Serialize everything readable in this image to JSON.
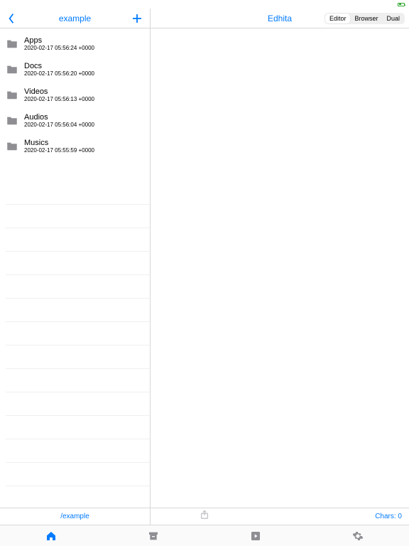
{
  "statusbar": {
    "indicator": ""
  },
  "nav": {
    "left_title": "example",
    "right_title": "Edhita",
    "segments": [
      "Editor",
      "Browser",
      "Dual"
    ],
    "selected_segment": 0
  },
  "folders": [
    {
      "name": "Apps",
      "ts": "2020-02-17 05:56:24 +0000"
    },
    {
      "name": "Docs",
      "ts": "2020-02-17 05:56:20 +0000"
    },
    {
      "name": "Videos",
      "ts": "2020-02-17 05:56:13 +0000"
    },
    {
      "name": "Audios",
      "ts": "2020-02-17 05:56:04 +0000"
    },
    {
      "name": "Musics",
      "ts": "2020-02-17 05:55:59 +0000"
    }
  ],
  "strip": {
    "path": "/example",
    "chars_label": "Chars: 0"
  },
  "tabs": {
    "active": 0,
    "items": [
      "home",
      "archive",
      "play",
      "settings"
    ]
  },
  "colors": {
    "accent": "#007aff",
    "icon_gray": "#8e8e93",
    "separator": "#d8d8d8"
  }
}
